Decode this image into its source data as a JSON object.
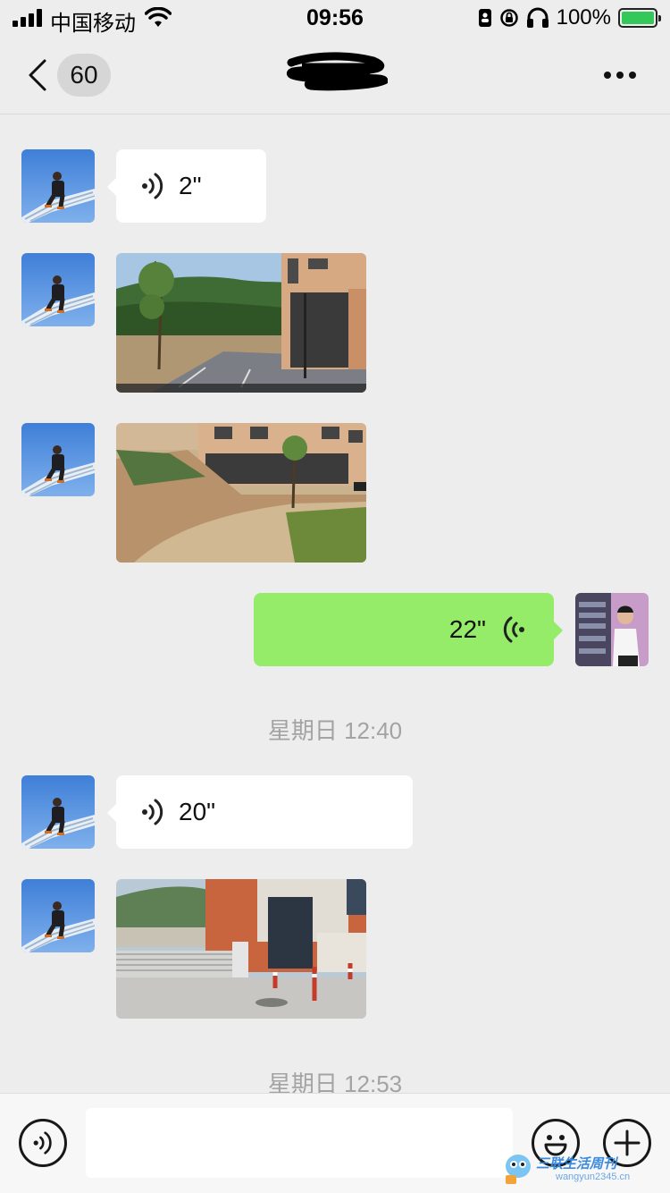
{
  "status_bar": {
    "carrier": "中国移动",
    "time": "09:56",
    "battery": "100%",
    "battery_level": 1.0
  },
  "nav": {
    "unread_count": "60",
    "title_redacted": true
  },
  "messages": [
    {
      "side": "left",
      "type": "voice",
      "duration": "2\""
    },
    {
      "side": "left",
      "type": "image",
      "icon": "photo-road-building"
    },
    {
      "side": "left",
      "type": "image",
      "icon": "photo-dirt-path"
    },
    {
      "side": "right",
      "type": "voice",
      "duration": "22\""
    },
    {
      "side": "center",
      "type": "timestamp",
      "text": "星期日 12:40"
    },
    {
      "side": "left",
      "type": "voice",
      "duration": "20\""
    },
    {
      "side": "left",
      "type": "image",
      "icon": "photo-gate"
    },
    {
      "side": "center",
      "type": "timestamp",
      "text": "星期日 12:53"
    }
  ],
  "input_bar": {
    "placeholder": "",
    "voice_icon": "voice-mode-icon",
    "emoji_icon": "emoji-icon",
    "plus_icon": "plus-icon"
  },
  "watermark": {
    "text": "三联生活周刊",
    "url": "wangyun2345.cn"
  },
  "colors": {
    "background": "#ededed",
    "sent_bubble": "#95ec69",
    "received_bubble": "#ffffff",
    "timestamp_text": "#a3a3a3"
  }
}
